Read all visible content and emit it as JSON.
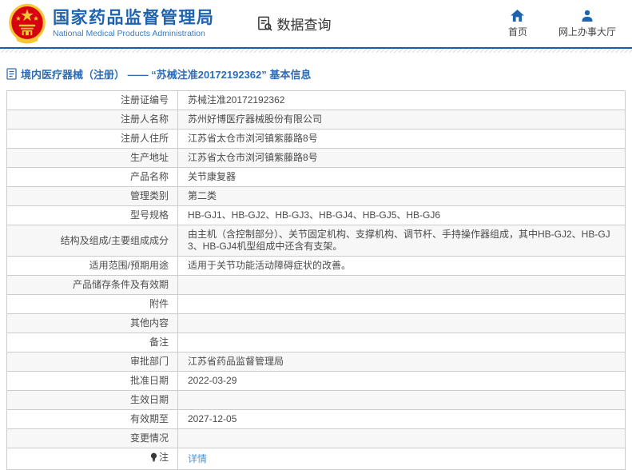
{
  "header": {
    "org_name_zh": "国家药品监督管理局",
    "org_name_en": "National Medical Products Administration",
    "data_query_label": "数据查询",
    "nav": [
      {
        "label": "首页",
        "icon": "home-icon"
      },
      {
        "label": "网上办事大厅",
        "icon": "user-icon"
      }
    ]
  },
  "breadcrumb": {
    "icon": "document-icon",
    "text": "境内医疗器械（注册） —— “苏械注准20172192362” 基本信息"
  },
  "table": {
    "rows": [
      {
        "label": "注册证编号",
        "value": "苏械注准20172192362"
      },
      {
        "label": "注册人名称",
        "value": "苏州好博医疗器械股份有限公司"
      },
      {
        "label": "注册人住所",
        "value": "江苏省太仓市浏河镇紫藤路8号"
      },
      {
        "label": "生产地址",
        "value": "江苏省太仓市浏河镇紫藤路8号"
      },
      {
        "label": "产品名称",
        "value": "关节康复器"
      },
      {
        "label": "管理类别",
        "value": "第二类"
      },
      {
        "label": "型号规格",
        "value": "HB-GJ1、HB-GJ2、HB-GJ3、HB-GJ4、HB-GJ5、HB-GJ6"
      },
      {
        "label": "结构及组成/主要组成成分",
        "value": "由主机（含控制部分）、关节固定机构、支撑机构、调节杆、手持操作器组成，其中HB-GJ2、HB-GJ3、HB-GJ4机型组成中还含有支架。"
      },
      {
        "label": "适用范围/预期用途",
        "value": "适用于关节功能活动障碍症状的改善。"
      },
      {
        "label": "产品储存条件及有效期",
        "value": ""
      },
      {
        "label": "附件",
        "value": ""
      },
      {
        "label": "其他内容",
        "value": ""
      },
      {
        "label": "备注",
        "value": ""
      },
      {
        "label": "审批部门",
        "value": "江苏省药品监督管理局"
      },
      {
        "label": "批准日期",
        "value": "2022-03-29"
      },
      {
        "label": "生效日期",
        "value": ""
      },
      {
        "label": "有效期至",
        "value": "2027-12-05"
      },
      {
        "label": "变更情况",
        "value": ""
      },
      {
        "label": "注",
        "value": "详情",
        "is_link": true,
        "label_icon": "bulb-icon"
      }
    ]
  },
  "colors": {
    "accent_blue": "#1f63ae",
    "header_rule_blue": "#1b5cab",
    "breadcrumb_blue": "#2e6cb5",
    "link_blue": "#4d94d9",
    "row_alt_bg": "#f7f7f7",
    "table_border": "#cccccc",
    "emblem_red": "#d7000f",
    "emblem_gold": "#f7c634"
  }
}
